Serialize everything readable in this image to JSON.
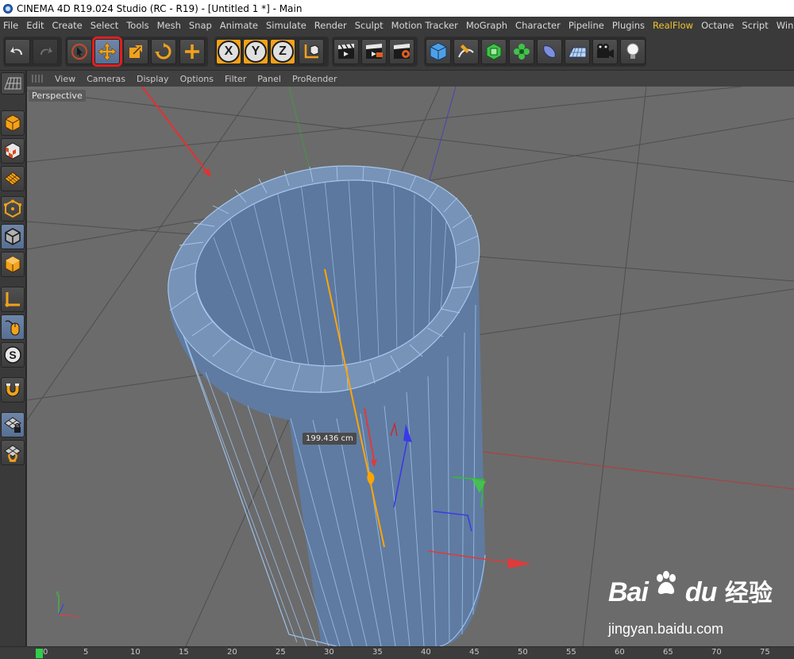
{
  "window": {
    "title": "CINEMA 4D R19.024 Studio (RC - R19) - [Untitled 1 *] - Main"
  },
  "menu": {
    "items": [
      "File",
      "Edit",
      "Create",
      "Select",
      "Tools",
      "Mesh",
      "Snap",
      "Animate",
      "Simulate",
      "Render",
      "Sculpt",
      "Motion Tracker",
      "MoGraph",
      "Character",
      "Pipeline",
      "Plugins",
      "RealFlow",
      "Octane",
      "Script",
      "Window"
    ],
    "highlight_color": "#f1c32c"
  },
  "toolbar": {
    "icons": [
      "undo-icon",
      "redo-icon",
      "live-selection-icon",
      "move-icon",
      "scale-icon",
      "rotate-icon",
      "recent-tool-icon",
      "x-axis-icon",
      "y-axis-icon",
      "z-axis-icon",
      "coordinate-system-icon",
      "render-view-icon",
      "render-picture-viewer-icon",
      "edit-render-settings-icon",
      "cube-icon",
      "pen-icon",
      "subdivision-icon",
      "cloner-icon",
      "deformer-icon",
      "floor-icon",
      "camera-icon",
      "light-icon"
    ],
    "x_label": "X",
    "y_label": "Y",
    "z_label": "Z",
    "selected_tool": "move-icon",
    "highlight_box_color": "#e02020"
  },
  "viewport_menu": {
    "items": [
      "View",
      "Cameras",
      "Display",
      "Options",
      "Filter",
      "Panel",
      "ProRender"
    ]
  },
  "viewport": {
    "camera_label": "Perspective",
    "measure_label": "199.436 cm",
    "background_color": "#6b6b6b",
    "mesh_color": "#5f7ba1",
    "edge_color": "#9dc0ea",
    "selection_color": "#ffa500"
  },
  "sidebar": {
    "icons": [
      "grid-icon",
      "model-mode-icon",
      "texture-mode-icon",
      "workplane-icon",
      "points-mode-icon",
      "edges-mode-icon",
      "polygons-mode-icon",
      "axis-mode-icon",
      "tweak-mode-icon",
      "solo-icon",
      "snap-icon",
      "locked-workplane-icon",
      "planar-workplane-icon"
    ]
  },
  "timeline": {
    "ticks": [
      "0",
      "5",
      "10",
      "15",
      "20",
      "25",
      "30",
      "35",
      "40",
      "45",
      "50",
      "55",
      "60",
      "65",
      "70",
      "75"
    ]
  },
  "watermark": {
    "brand_left": "Bai",
    "brand_right": "du",
    "brand_cn": "经验",
    "url": "jingyan.baidu.com"
  }
}
